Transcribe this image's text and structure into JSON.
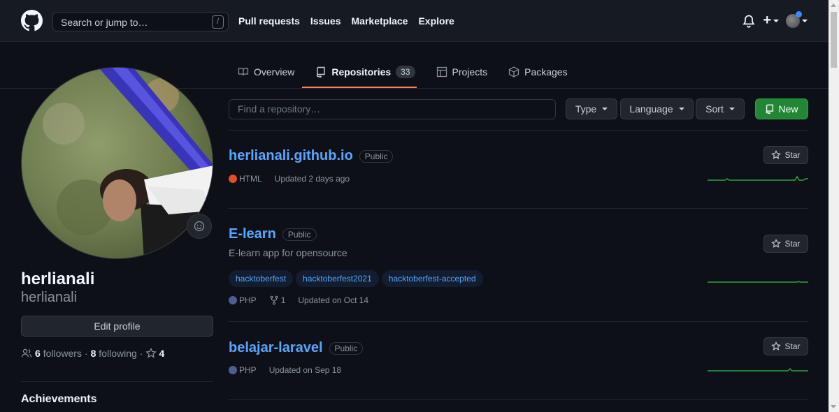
{
  "header": {
    "logo_icon": "github-octocat-icon",
    "search_placeholder": "Search or jump to…",
    "search_shortcut": "/",
    "nav": [
      "Pull requests",
      "Issues",
      "Marketplace",
      "Explore"
    ],
    "plus_label": "+"
  },
  "tabs": [
    {
      "label": "Overview",
      "icon": "book-icon"
    },
    {
      "label": "Repositories",
      "icon": "repo-icon",
      "count": "33",
      "active": true
    },
    {
      "label": "Projects",
      "icon": "table-icon"
    },
    {
      "label": "Packages",
      "icon": "package-icon"
    }
  ],
  "profile": {
    "fullname": "herlianali",
    "username": "herlianali",
    "edit_label": "Edit profile",
    "followers_count": "6",
    "followers_label": "followers",
    "separator": "·",
    "following_count": "8",
    "following_label": "following",
    "stars_count": "4",
    "achievements_label": "Achievements"
  },
  "filters": {
    "find_placeholder": "Find a repository…",
    "type_label": "Type",
    "language_label": "Language",
    "sort_label": "Sort",
    "new_label": "New"
  },
  "repos": [
    {
      "name": "herlianali.github.io",
      "visibility": "Public",
      "language": "HTML",
      "language_color": "#e34c26",
      "updated": "Updated 2 days ago",
      "star_label": "Star"
    },
    {
      "name": "E-learn",
      "visibility": "Public",
      "description": "E-learn app for opensource",
      "topics": [
        "hacktoberfest",
        "hacktoberfest2021",
        "hacktoberfest-accepted"
      ],
      "language": "PHP",
      "language_color": "#4f5d95",
      "forks": "1",
      "updated": "Updated on Oct 14",
      "star_label": "Star"
    },
    {
      "name": "belajar-laravel",
      "visibility": "Public",
      "language": "PHP",
      "language_color": "#4f5d95",
      "updated": "Updated on Sep 18",
      "star_label": "Star"
    }
  ],
  "colors": {
    "accent_link": "#58a6ff",
    "new_button": "#238636",
    "tab_underline": "#f78166",
    "sparkline": "#2ea043"
  }
}
